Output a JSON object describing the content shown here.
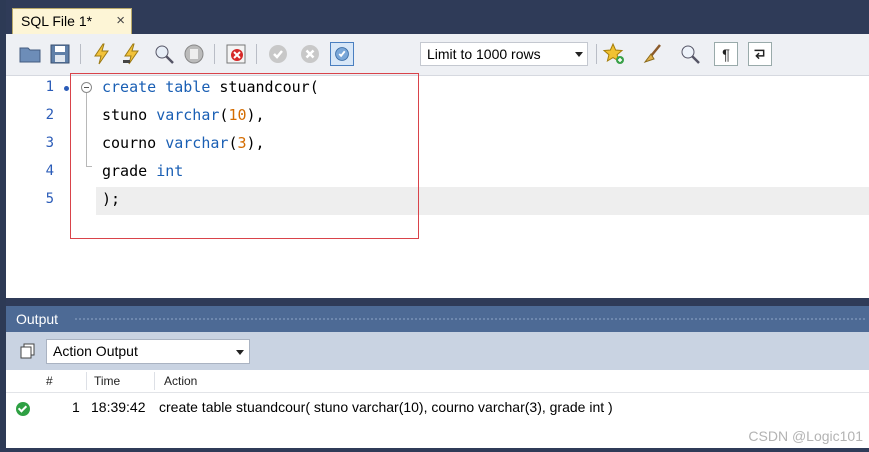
{
  "tab": {
    "title": "SQL File 1*",
    "close": "×"
  },
  "toolbar": {
    "limit_value": "Limit to 1000 rows",
    "icons": [
      "open-folder-icon",
      "save-icon",
      "execute-icon",
      "execute-current-icon",
      "explain-icon",
      "stop-icon",
      "toggle-error-icon",
      "commit-icon",
      "rollback-icon",
      "autocommit-icon",
      "bookmark-star-icon",
      "beautify-broom-icon",
      "find-icon",
      "invisible-chars-icon",
      "wrap-icon"
    ]
  },
  "editor": {
    "line_numbers": [
      "1",
      "2",
      "3",
      "4",
      "5"
    ],
    "lines": [
      [
        {
          "t": "create table ",
          "c": "kw"
        },
        {
          "t": "stuandcour(",
          "c": ""
        }
      ],
      [
        {
          "t": "stuno ",
          "c": ""
        },
        {
          "t": "varchar",
          "c": "kw"
        },
        {
          "t": "(",
          "c": ""
        },
        {
          "t": "10",
          "c": "num"
        },
        {
          "t": "),",
          "c": ""
        }
      ],
      [
        {
          "t": "courno ",
          "c": ""
        },
        {
          "t": "varchar",
          "c": "kw"
        },
        {
          "t": "(",
          "c": ""
        },
        {
          "t": "3",
          "c": "num"
        },
        {
          "t": "),",
          "c": ""
        }
      ],
      [
        {
          "t": "grade ",
          "c": ""
        },
        {
          "t": "int",
          "c": "kw"
        }
      ],
      [
        {
          "t": ");",
          "c": ""
        }
      ]
    ]
  },
  "output": {
    "title": "Output",
    "mode": "Action Output",
    "columns": {
      "num": "#",
      "time": "Time",
      "action": "Action"
    },
    "rows": [
      {
        "status": "ok",
        "num": "1",
        "time": "18:39:42",
        "action": "create table stuandcour( stuno varchar(10), courno varchar(3), grade int )"
      }
    ]
  },
  "watermark": "CSDN @Logic101",
  "colors": {
    "accent_blue": "#1a5fb4",
    "number_orange": "#d46c00",
    "highlight_red": "#d9434a"
  }
}
